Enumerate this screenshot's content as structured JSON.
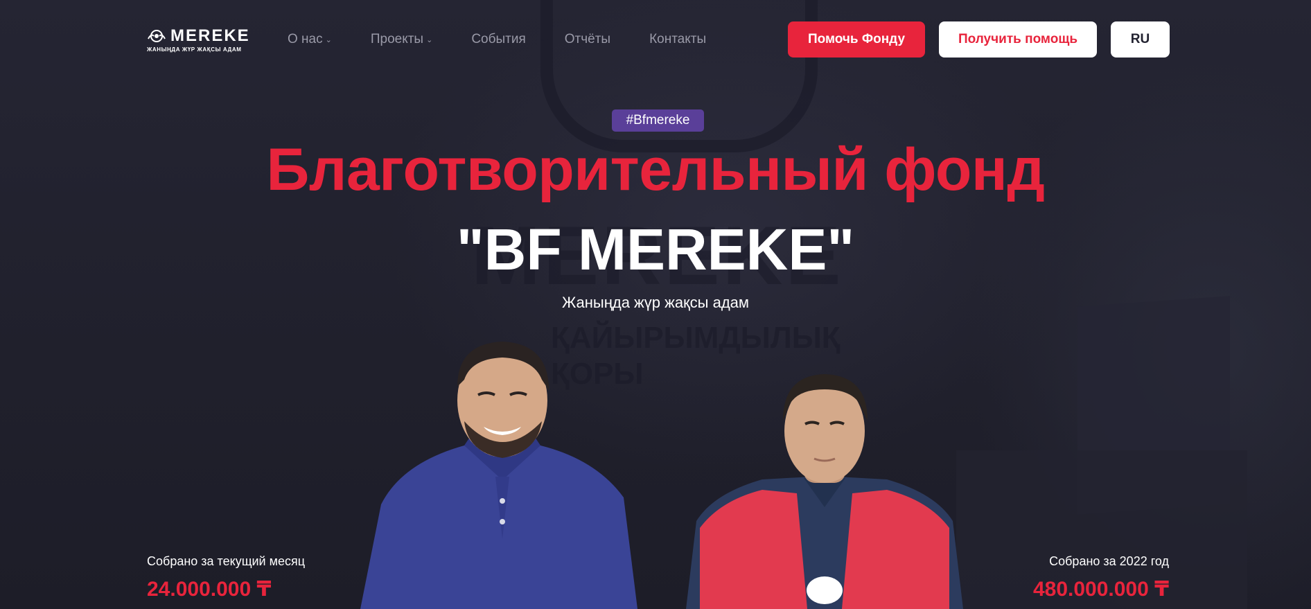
{
  "header": {
    "logo_name": "MEREKE",
    "logo_tagline": "ЖАНЫҢДА ЖҮР ЖАҚСЫ АДАМ",
    "nav": [
      {
        "label": "О нас",
        "has_dropdown": true
      },
      {
        "label": "Проекты",
        "has_dropdown": true
      },
      {
        "label": "События",
        "has_dropdown": false
      },
      {
        "label": "Отчёты",
        "has_dropdown": false
      },
      {
        "label": "Контакты",
        "has_dropdown": false
      }
    ],
    "help_fund_label": "Помочь Фонду",
    "get_help_label": "Получить помощь",
    "language_label": "RU"
  },
  "hero": {
    "hashtag": "#Bfmereke",
    "title": "Благотворительный фонд",
    "name": "\"BF MEREKE\"",
    "subtitle": "Жаныңда жүр жақсы адам"
  },
  "background": {
    "wall_text": "MEREKE",
    "wall_subtext_line1": "ҚАЙЫРЫМДЫЛЫҚ",
    "wall_subtext_line2": "ҚОРЫ"
  },
  "stats": {
    "month_label": "Собрано за текущий месяц",
    "month_value": "24.000.000 ₸",
    "year_label": "Собрано за 2022 год",
    "year_value": "480.000.000 ₸"
  },
  "colors": {
    "accent_red": "#e8243c",
    "hashtag_purple": "#5a3f99",
    "background": "#22222f",
    "nav_gray": "#9a9aa8"
  },
  "icons": {
    "logo": "mereke-logo-icon",
    "dropdown": "chevron-down-icon"
  }
}
